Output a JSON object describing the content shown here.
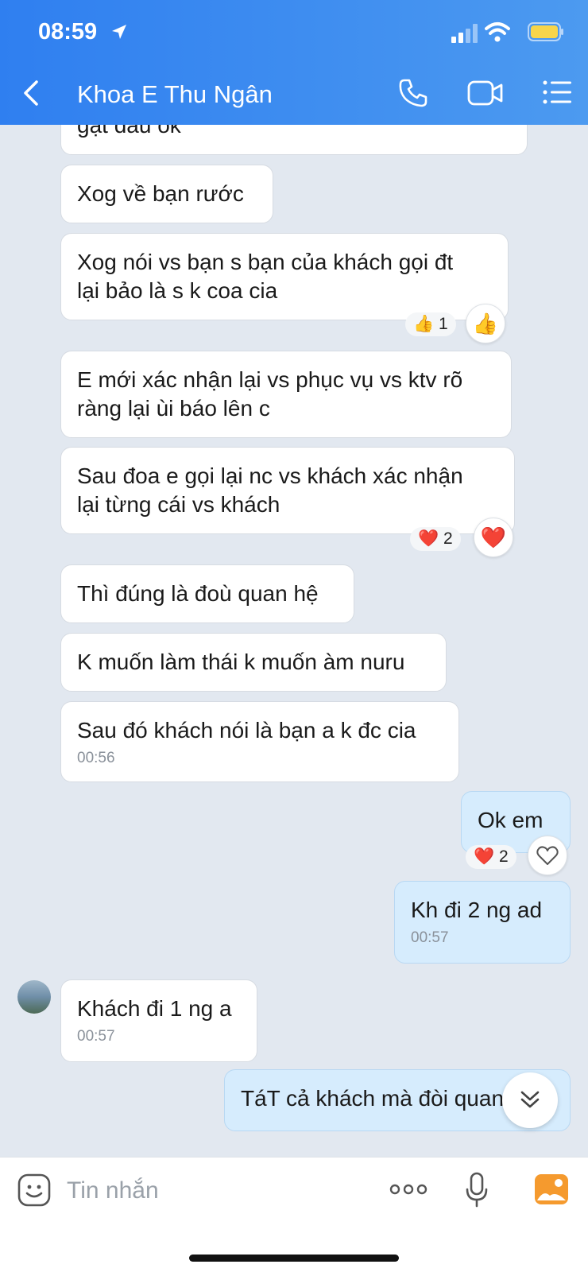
{
  "status_bar": {
    "time": "08:59"
  },
  "header": {
    "title": "Khoa E Thu Ngân"
  },
  "messages": [
    {
      "text": "gật đầu ok"
    },
    {
      "text": "Xog về bạn rước"
    },
    {
      "text": "Xog nói vs bạn s bạn của khách gọi đt\nlại bảo là s k coa cia",
      "reaction": {
        "emoji": "👍",
        "count": "1"
      }
    },
    {
      "text": "E mới xác nhận lại vs phục vụ vs ktv rõ\nràng lại ùi báo lên c"
    },
    {
      "text": "Sau đoa e gọi lại nc vs khách xác nhận\nlại từng cái vs khách",
      "reaction": {
        "emoji": "❤️",
        "count": "2"
      }
    },
    {
      "text": "Thì đúng là đoù quan hệ"
    },
    {
      "text": "K muốn làm thái k muốn àm nuru"
    },
    {
      "text": "Sau đó khách nói là bạn a k đc cia",
      "time": "00:56"
    },
    {
      "text": "Ok em",
      "reaction": {
        "emoji": "❤️",
        "count": "2"
      }
    },
    {
      "text": "Kh đi 2 ng ad",
      "time": "00:57"
    },
    {
      "text": "Khách đi 1 ng a",
      "time": "00:57"
    },
    {
      "text": "TáT cả khách mà đòi quan hệ"
    }
  ],
  "composer": {
    "placeholder": "Tin nhắn"
  },
  "colors": {
    "header": "#2f7ff0",
    "outgoing_bubble": "#d6ecfd",
    "incoming_bubble": "#ffffff",
    "background": "#e2e8f0"
  }
}
